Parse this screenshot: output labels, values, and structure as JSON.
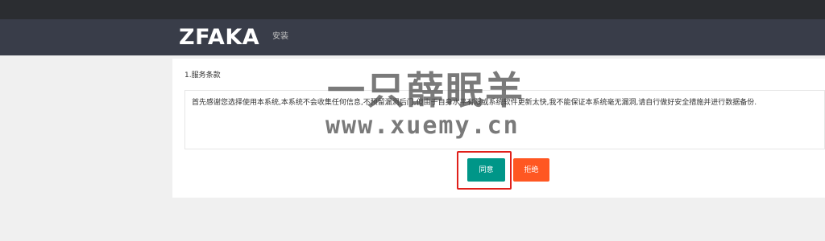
{
  "header": {
    "logo_text": "ZFAKA",
    "nav_items": [
      {
        "label": "安装"
      }
    ]
  },
  "main": {
    "section_title": "1.服务条款",
    "terms_text": "首先感谢您选择使用本系统,本系统不会收集任何信息,不预留漏洞后门,但由于自身水平有限或系统软件更新太快,我不能保证本系统毫无漏洞,请自行做好安全措施并进行数据备份.",
    "agree_label": "同意",
    "refuse_label": "拒绝"
  },
  "watermark": {
    "title": "一只薛眠羊",
    "url": "www.xuemy.cn"
  },
  "colors": {
    "topbar": "#2b2d31",
    "navbar": "#393d49",
    "agree": "#009688",
    "refuse": "#ff5722",
    "highlight": "#e0201a"
  }
}
